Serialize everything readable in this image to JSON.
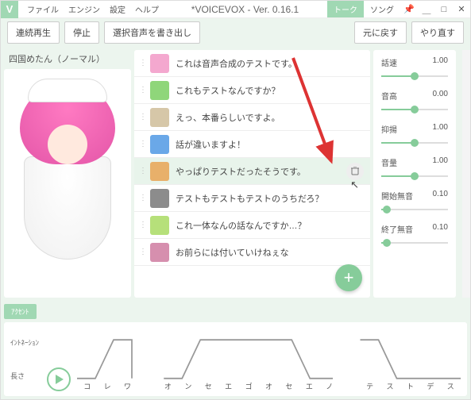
{
  "title": "*VOICEVOX - Ver. 0.16.1",
  "menu": [
    "ファイル",
    "エンジン",
    "設定",
    "ヘルプ"
  ],
  "modes": {
    "talk": "トーク",
    "song": "ソング"
  },
  "toolbar": {
    "play_all": "連続再生",
    "stop": "停止",
    "export": "選択音声を書き出し",
    "undo": "元に戻す",
    "redo": "やり直す"
  },
  "character_name": "四国めたん（ノーマル）",
  "lines": [
    {
      "text": "これは音声合成のテストです。",
      "avatar": "#f4a8cf"
    },
    {
      "text": "これもテストなんですか？",
      "avatar": "#8fd67a"
    },
    {
      "text": "えっ、本番らしいですよ。",
      "avatar": "#d6c7a8"
    },
    {
      "text": "話が違いますよ！",
      "avatar": "#6aa8e8"
    },
    {
      "text": "やっぱりテストだったそうです。",
      "avatar": "#e8b06a",
      "selected": true,
      "show_delete": true
    },
    {
      "text": "テストもテストもテストのうちだろ？",
      "avatar": "#8c8c8c"
    },
    {
      "text": "これ一体なんの話なんですか…？",
      "avatar": "#b6e07a"
    },
    {
      "text": "お前らには付いていけねぇな",
      "avatar": "#d68fae"
    }
  ],
  "params": [
    {
      "label": "話速",
      "value": "1.00",
      "pos": 50
    },
    {
      "label": "音高",
      "value": "0.00",
      "pos": 50
    },
    {
      "label": "抑揚",
      "value": "1.00",
      "pos": 50
    },
    {
      "label": "音量",
      "value": "1.00",
      "pos": 50
    },
    {
      "label": "開始無音",
      "value": "0.10",
      "pos": 8
    },
    {
      "label": "終了無音",
      "value": "0.10",
      "pos": 8
    }
  ],
  "tabs": {
    "accent": "ｱｸｾﾝﾄ",
    "intonation": "ｲﾝﾄﾈｰｼｮﾝ",
    "length": "長さ"
  },
  "moras": [
    "コ",
    "レ",
    "ワ",
    "",
    "オ",
    "ン",
    "セ",
    "エ",
    "ゴ",
    "オ",
    "セ",
    "エ",
    "ノ",
    "",
    "テ",
    "ス",
    "ト",
    "デ",
    "ス"
  ]
}
